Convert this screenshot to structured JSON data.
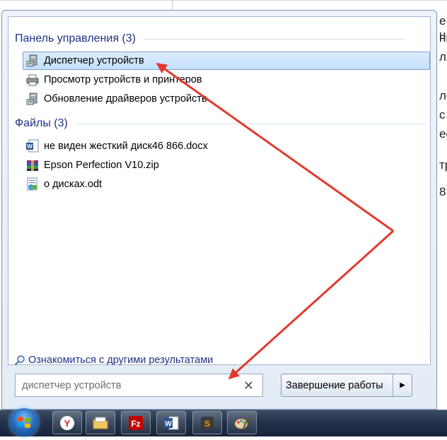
{
  "background_doc": {
    "fragments": [
      "е н",
      "ны",
      "ля",
      "ле",
      "с",
      "ес",
      "тр",
      "8"
    ]
  },
  "start_menu": {
    "groups": [
      {
        "title": "Панель управления (3)",
        "items": [
          {
            "label": "Диспетчер устройств",
            "icon": "device-manager-icon",
            "selected": true
          },
          {
            "label": "Просмотр устройств и принтеров",
            "icon": "printer-icon",
            "selected": false
          },
          {
            "label": "Обновление драйверов устройств",
            "icon": "device-manager-icon",
            "selected": false
          }
        ]
      },
      {
        "title": "Файлы (3)",
        "items": [
          {
            "label": "не виден жесткий диск46 866.docx",
            "icon": "word-document-icon",
            "selected": false
          },
          {
            "label": "Epson Perfection V10.zip",
            "icon": "winrar-archive-icon",
            "selected": false
          },
          {
            "label": "о дисках.odt",
            "icon": "odt-document-icon",
            "selected": false
          }
        ]
      }
    ],
    "more_results": "Ознакомиться с другими результатами",
    "search": {
      "value": "диспетчер устройств",
      "clear_glyph": "✕"
    },
    "shutdown": {
      "label": "Завершение работы",
      "arrow": "▶"
    }
  },
  "taskbar": {
    "pinned": [
      "yandex-browser-icon",
      "file-explorer-icon",
      "filezilla-icon",
      "word-icon",
      "sublime-text-icon",
      "paint-icon"
    ]
  },
  "colors": {
    "group_header": "#1e3287",
    "arrow": "#e03a2c",
    "selection": "#c4e0fc"
  }
}
